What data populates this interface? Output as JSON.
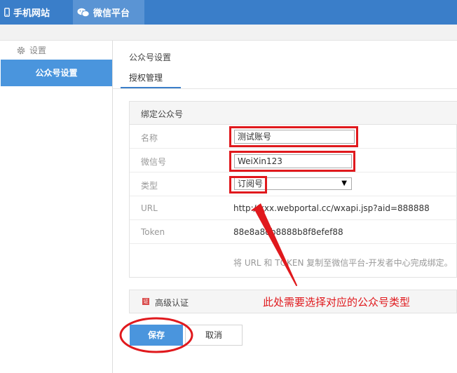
{
  "topnav": {
    "mobile_label": "手机网站",
    "wechat_label": "微信平台"
  },
  "sidebar": {
    "header": "设置",
    "items": [
      {
        "label": "公众号设置",
        "active": true
      }
    ]
  },
  "main": {
    "title": "公众号设置",
    "tabs": [
      {
        "label": "授权管理",
        "active": true
      }
    ]
  },
  "bind_panel": {
    "title": "绑定公众号",
    "name_label": "名称",
    "name_value": "测试账号",
    "wechat_id_label": "微信号",
    "wechat_id_value": "WeiXin123",
    "type_label": "类型",
    "type_value": "订阅号",
    "url_label": "URL",
    "url_value": "http://xxx.webportal.cc/wxapi.jsp?aid=888888",
    "token_label": "Token",
    "token_value": "88e8a8db8888b8f8efef88",
    "hint": "将 URL 和 TOKEN 复制至微信平台-开发者中心完成绑定。"
  },
  "advanced": {
    "label": "高级认证",
    "icon": "certificate-icon"
  },
  "annotation": "此处需要选择对应的公众号类型",
  "buttons": {
    "save": "保存",
    "cancel": "取消"
  },
  "colors": {
    "topbar": "#3a7ec9",
    "accent": "#4a95dd",
    "annotation_red": "#e0191d"
  }
}
